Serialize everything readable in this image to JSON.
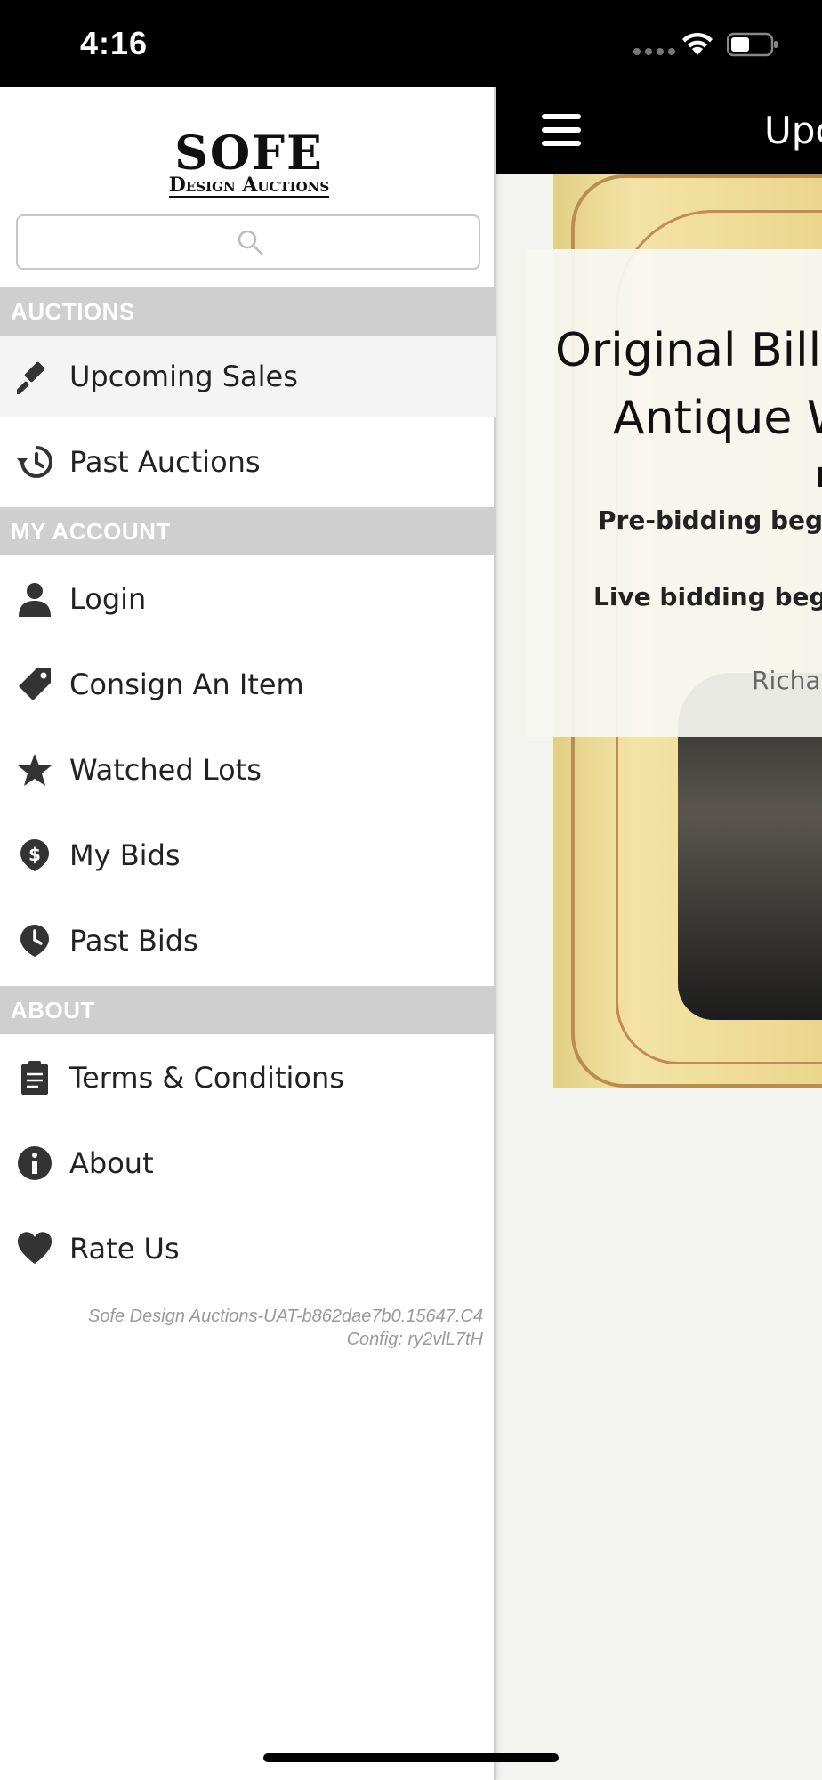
{
  "status_bar": {
    "time": "4:16"
  },
  "nav": {
    "title": "Upcoming Sales"
  },
  "sale": {
    "title_line1": "Original Billy",
    "title_line2": "Antique W",
    "date_fragment": "I",
    "prebid_text": "Pre-bidding begi",
    "livebid_text": "Live bidding begi",
    "location_text": "Richar"
  },
  "drawer": {
    "logo_main": "SOFE",
    "logo_sub": "Design Auctions",
    "search": {
      "placeholder": "",
      "value": ""
    },
    "sections": [
      {
        "header": "AUCTIONS",
        "items": [
          {
            "label": "Upcoming Sales",
            "icon": "gavel-icon",
            "active": true
          },
          {
            "label": "Past Auctions",
            "icon": "history-icon"
          }
        ]
      },
      {
        "header": "MY ACCOUNT",
        "items": [
          {
            "label": "Login",
            "icon": "user-icon"
          },
          {
            "label": "Consign An Item",
            "icon": "tag-icon"
          },
          {
            "label": "Watched Lots",
            "icon": "star-icon"
          },
          {
            "label": "My Bids",
            "icon": "dollar-pin-icon"
          },
          {
            "label": "Past Bids",
            "icon": "clock-pin-icon"
          }
        ]
      },
      {
        "header": "ABOUT",
        "items": [
          {
            "label": "Terms & Conditions",
            "icon": "clipboard-icon"
          },
          {
            "label": "About",
            "icon": "info-icon"
          },
          {
            "label": "Rate Us",
            "icon": "heart-icon"
          }
        ]
      }
    ],
    "build": "Sofe Design Auctions-UAT-b862dae7b0.15647.C4",
    "config": "Config: ry2vlL7tH"
  }
}
